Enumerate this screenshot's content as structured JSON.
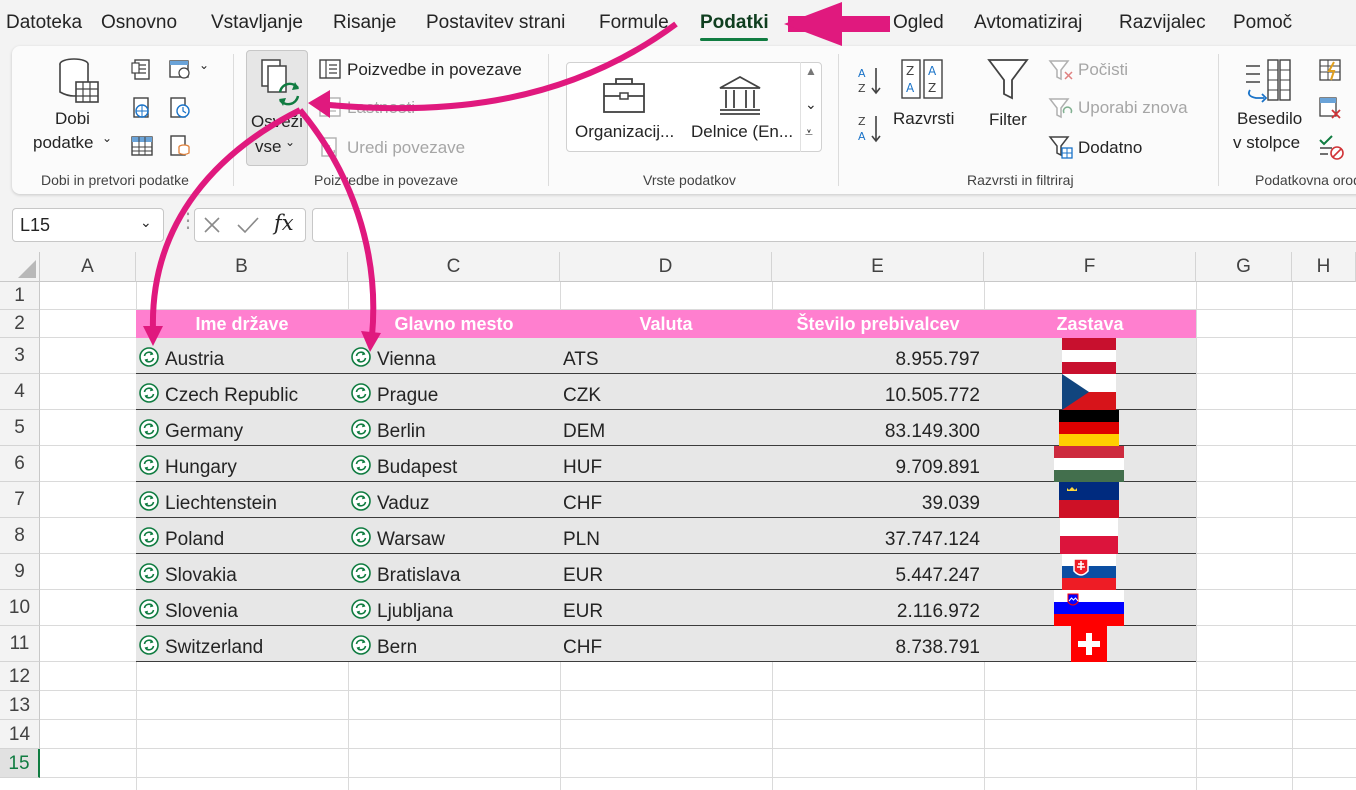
{
  "menu": {
    "tabs": [
      "Datoteka",
      "Osnovno",
      "Vstavljanje",
      "Risanje",
      "Postavitev strani",
      "Formule",
      "Podatki",
      "Ogled",
      "Avtomatiziraj",
      "Razvijalec",
      "Pomoč"
    ],
    "active": "Podatki"
  },
  "ribbon": {
    "get_data_line1": "Dobi",
    "get_data_line2": "podatke",
    "group_get": "Dobi in pretvori podatke",
    "refresh_line1": "Osveži",
    "refresh_line2": "vse",
    "queries_connections": "Poizvedbe in povezave",
    "properties": "Lastnosti",
    "edit_links": "Uredi povezave",
    "group_queries": "Poizvedbe in povezave",
    "dtype_org": "Organizacij...",
    "dtype_stocks": "Delnice (En...",
    "group_dtypes": "Vrste podatkov",
    "sort": "Razvrsti",
    "filter": "Filter",
    "clear": "Počisti",
    "reapply": "Uporabi znova",
    "advanced": "Dodatno",
    "group_sort": "Razvrsti in filtriraj",
    "text_to_cols_line1": "Besedilo",
    "text_to_cols_line2": "v stolpce",
    "group_datatools": "Podatkovna orodja"
  },
  "formula_bar": {
    "name_box": "L15",
    "fx": "fx"
  },
  "sheet": {
    "columns": [
      "A",
      "B",
      "C",
      "D",
      "E",
      "F",
      "G",
      "H"
    ],
    "rows": [
      "1",
      "2",
      "3",
      "4",
      "5",
      "6",
      "7",
      "8",
      "9",
      "10",
      "11",
      "12",
      "13",
      "14",
      "15"
    ],
    "selected_row": "15",
    "headers": [
      "Ime države",
      "Glavno mesto",
      "Valuta",
      "Število prebivalcev",
      "Zastava"
    ],
    "header_color": "#ff7fcf",
    "data": [
      {
        "country": "Austria",
        "capital": "Vienna",
        "currency": "ATS",
        "population": "8.955.797",
        "flag": "austria"
      },
      {
        "country": "Czech Republic",
        "capital": "Prague",
        "currency": "CZK",
        "population": "10.505.772",
        "flag": "czech"
      },
      {
        "country": "Germany",
        "capital": "Berlin",
        "currency": "DEM",
        "population": "83.149.300",
        "flag": "germany"
      },
      {
        "country": "Hungary",
        "capital": "Budapest",
        "currency": "HUF",
        "population": "9.709.891",
        "flag": "hungary"
      },
      {
        "country": "Liechtenstein",
        "capital": "Vaduz",
        "currency": "CHF",
        "population": "39.039",
        "flag": "liechtenstein"
      },
      {
        "country": "Poland",
        "capital": "Warsaw",
        "currency": "PLN",
        "population": "37.747.124",
        "flag": "poland"
      },
      {
        "country": "Slovakia",
        "capital": "Bratislava",
        "currency": "EUR",
        "population": "5.447.247",
        "flag": "slovakia"
      },
      {
        "country": "Slovenia",
        "capital": "Ljubljana",
        "currency": "EUR",
        "population": "2.116.972",
        "flag": "slovenia"
      },
      {
        "country": "Switzerland",
        "capital": "Bern",
        "currency": "CHF",
        "population": "8.738.791",
        "flag": "switzerland"
      }
    ]
  },
  "colors": {
    "accent_green": "#107c41",
    "annotation_pink": "#e0197e"
  }
}
